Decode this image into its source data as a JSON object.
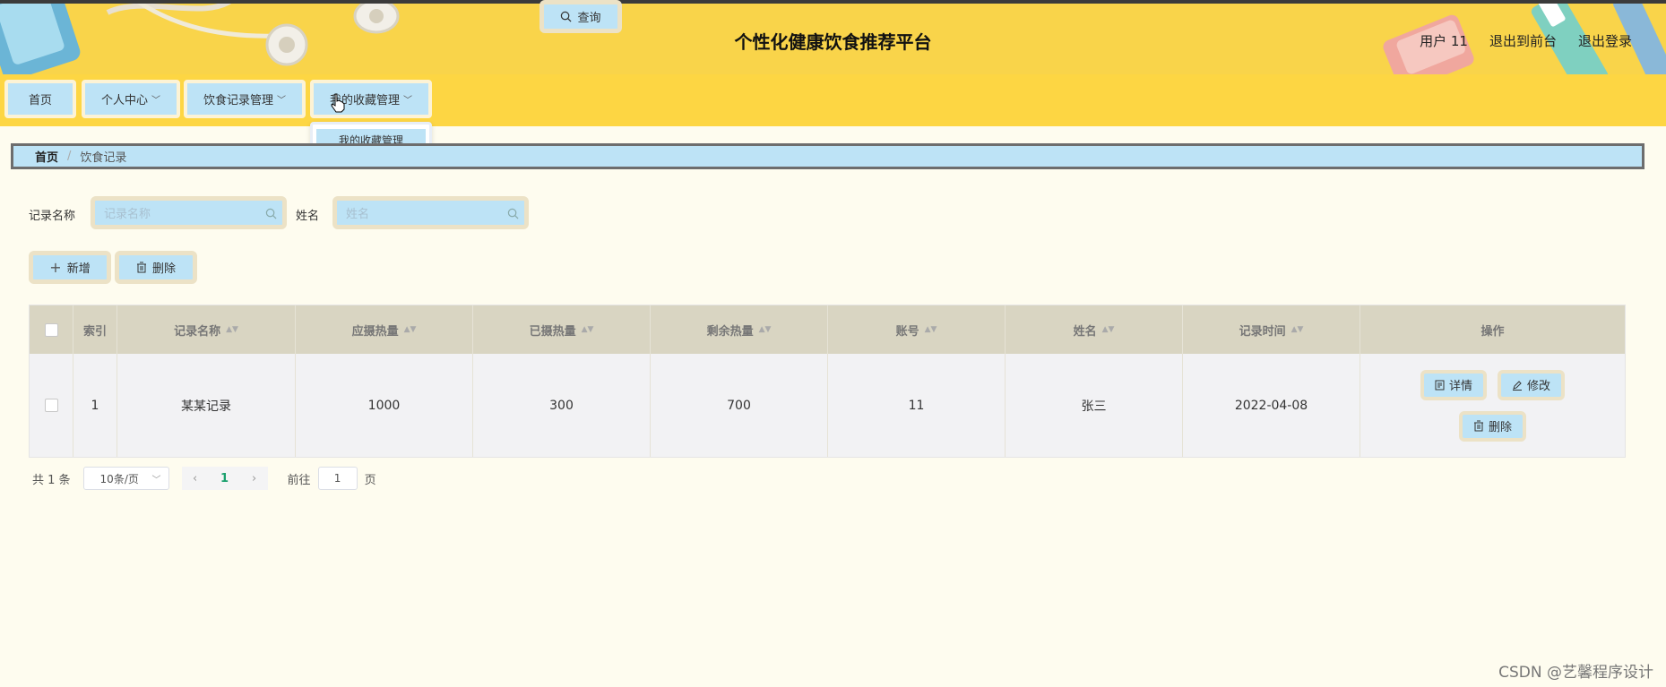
{
  "header": {
    "title": "个性化健康饮食推荐平台",
    "user": "用户 11",
    "exit_front": "退出到前台",
    "logout": "退出登录"
  },
  "nav": {
    "items": [
      {
        "label": "首页",
        "has_dropdown": false
      },
      {
        "label": "个人中心",
        "has_dropdown": true
      },
      {
        "label": "饮食记录管理",
        "has_dropdown": true
      },
      {
        "label": "我的收藏管理",
        "has_dropdown": true
      }
    ],
    "dropdown_item": "我的收藏管理"
  },
  "breadcrumb": {
    "home": "首页",
    "separator": "/",
    "current": "饮食记录"
  },
  "search": {
    "record_name_label": "记录名称",
    "record_name_placeholder": "记录名称",
    "name_label": "姓名",
    "name_placeholder": "姓名",
    "query_label": "查询"
  },
  "actions": {
    "add_label": "新增",
    "delete_label": "删除"
  },
  "table": {
    "headers": [
      "索引",
      "记录名称",
      "应摄热量",
      "已摄热量",
      "剩余热量",
      "账号",
      "姓名",
      "记录时间",
      "操作"
    ],
    "rows": [
      {
        "index": "1",
        "record_name": "某某记录",
        "should_intake": "1000",
        "intaken": "300",
        "remaining": "700",
        "account": "11",
        "name": "张三",
        "time": "2022-04-08"
      }
    ],
    "ops": {
      "detail": "详情",
      "edit": "修改",
      "delete": "删除"
    }
  },
  "pager": {
    "total": "共 1 条",
    "page_size": "10条/页",
    "current_page": "1",
    "goto_label": "前往",
    "goto_value": "1",
    "page_suffix": "页"
  },
  "watermark": "CSDN @艺馨程序设计",
  "colors": {
    "topbar": "#f9d44a",
    "button_bg": "#bde3f6",
    "page_bg": "#fefcef",
    "table_header": "#d9d5c2"
  }
}
